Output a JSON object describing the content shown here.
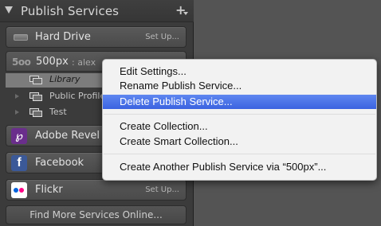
{
  "panel": {
    "title": "Publish Services",
    "add_glyph": "+"
  },
  "services": {
    "hard_drive": {
      "label": "Hard Drive",
      "setup": "Set Up..."
    },
    "px500": {
      "logo": "5oo",
      "name": "500px",
      "user": ": alex",
      "collections": [
        {
          "label": "Library",
          "selected": true
        },
        {
          "label": "Public Profile",
          "selected": false
        },
        {
          "label": "Test",
          "selected": false
        }
      ]
    },
    "adobe_revel": {
      "label": "Adobe Revel",
      "icon_glyph": "℘"
    },
    "facebook": {
      "label": "Facebook",
      "icon_glyph": "f"
    },
    "flickr": {
      "label": "Flickr",
      "setup": "Set Up..."
    },
    "find_more": "Find More Services Online..."
  },
  "context_menu": {
    "items": [
      "Edit Settings...",
      "Rename Publish Service...",
      "Delete Publish Service...",
      "Create Collection...",
      "Create Smart Collection...",
      "Create Another Publish Service via “500px”..."
    ],
    "highlighted_index": 2
  },
  "colors": {
    "menu_highlight": "#3d68e8",
    "revel": "#6a2e8c",
    "facebook": "#3b5998",
    "flickr_blue": "#0063dc",
    "flickr_pink": "#ff0084"
  }
}
